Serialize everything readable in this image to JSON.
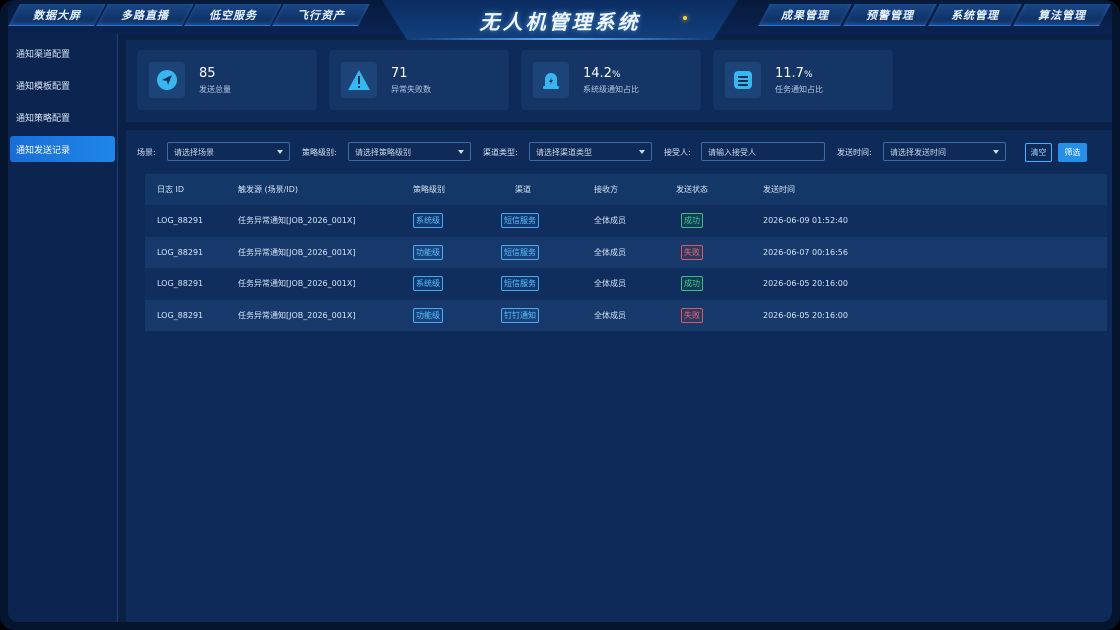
{
  "app": {
    "title": "无人机管理系统"
  },
  "top_nav": {
    "left": [
      "数据大屏",
      "多路直播",
      "低空服务",
      "飞行资产"
    ],
    "right": [
      "成果管理",
      "预警管理",
      "系统管理",
      "算法管理"
    ]
  },
  "sidebar": {
    "items": [
      {
        "label": "通知渠道配置",
        "active": false
      },
      {
        "label": "通知模板配置",
        "active": false
      },
      {
        "label": "通知策略配置",
        "active": false
      },
      {
        "label": "通知发送记录",
        "active": true
      }
    ]
  },
  "stats": [
    {
      "value": "85",
      "unit": "",
      "label": "发送总量",
      "icon": "send-icon"
    },
    {
      "value": "71",
      "unit": "",
      "label": "异常失败数",
      "icon": "warning-icon"
    },
    {
      "value": "14.2",
      "unit": "%",
      "label": "系统级通知占比",
      "icon": "alarm-icon"
    },
    {
      "value": "11.7",
      "unit": "%",
      "label": "任务通知占比",
      "icon": "list-icon"
    }
  ],
  "filters": {
    "scene_label": "场景:",
    "scene_placeholder": "请选择场景",
    "level_label": "策略级别:",
    "level_placeholder": "请选择策略级别",
    "channel_label": "渠道类型:",
    "channel_placeholder": "请选择渠道类型",
    "receiver_label": "接受人:",
    "receiver_placeholder": "请输入接受人",
    "time_label": "发送时间:",
    "time_placeholder": "请选择发送时间",
    "clear_label": "清空",
    "filter_label": "筛选"
  },
  "table": {
    "headers": [
      "日志 ID",
      "触发源 (场景/ID)",
      "策略级别",
      "渠道",
      "接收方",
      "发送状态",
      "发送时间"
    ],
    "rows": [
      {
        "id": "LOG_88291",
        "source": "任务异常通知[JOB_2026_001X]",
        "level": "系统级",
        "channel": "短信服务",
        "receiver": "全体成员",
        "status": "成功",
        "status_type": "ok",
        "time": "2026-06-09 01:52:40"
      },
      {
        "id": "LOG_88291",
        "source": "任务异常通知[JOB_2026_001X]",
        "level": "功能级",
        "channel": "短信服务",
        "receiver": "全体成员",
        "status": "失败",
        "status_type": "fail",
        "time": "2026-06-07 00:16:56"
      },
      {
        "id": "LOG_88291",
        "source": "任务异常通知[JOB_2026_001X]",
        "level": "系统级",
        "channel": "短信服务",
        "receiver": "全体成员",
        "status": "成功",
        "status_type": "ok",
        "time": "2026-06-05 20:16:00"
      },
      {
        "id": "LOG_88291",
        "source": "任务异常通知[JOB_2026_001X]",
        "level": "功能级",
        "channel": "钉钉通知",
        "receiver": "全体成员",
        "status": "失败",
        "status_type": "fail",
        "time": "2026-06-05 20:16:00"
      }
    ]
  },
  "colors": {
    "accent": "#2690e8",
    "success": "#3fd080",
    "failure": "#f06a6a",
    "background": "#0a2046"
  }
}
